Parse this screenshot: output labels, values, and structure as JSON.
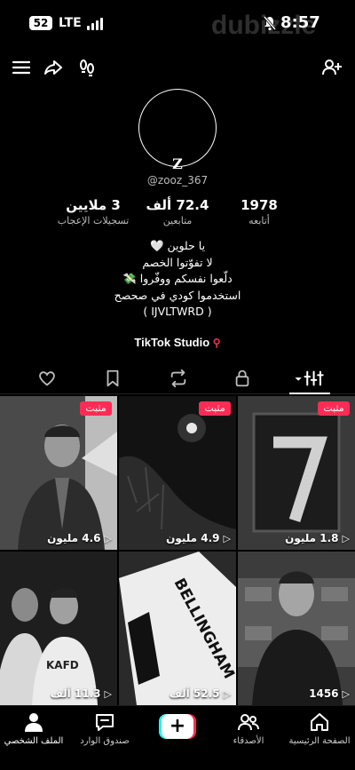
{
  "status_bar": {
    "signal_badge": "52",
    "network": "LTE",
    "watermark": "dubizzle",
    "time": "8:57"
  },
  "profile": {
    "display_name": "Z",
    "username": "@zooz_367",
    "stats": [
      {
        "value": "1978",
        "label": "أتابعه"
      },
      {
        "value": "72.4 ألف",
        "label": "متابعين"
      },
      {
        "value": "3 ملايين",
        "label": "تسجيلات الإعجاب"
      }
    ],
    "bio_lines": [
      "يا حلوين 🤍",
      "لا تفوّتوا الخصم",
      "دلّعوا نفسكم ووفّروا 💸",
      "استخدموا كودي في صحصح",
      "( IJVLTWRD )"
    ],
    "studio_label": "TikTok Studio"
  },
  "tabs": [
    {
      "name": "videos",
      "icon": "grid-icon",
      "active": true
    },
    {
      "name": "private",
      "icon": "lock-icon"
    },
    {
      "name": "reposts",
      "icon": "repost-icon"
    },
    {
      "name": "favorites",
      "icon": "bookmark-icon"
    },
    {
      "name": "liked",
      "icon": "heart-icon"
    }
  ],
  "videos": [
    {
      "pinned": true,
      "pin_label": "مثبت",
      "views": "1.8 مليون",
      "thumb": "number-7"
    },
    {
      "pinned": true,
      "pin_label": "مثبت",
      "views": "4.9 مليون",
      "thumb": "night-moon"
    },
    {
      "pinned": true,
      "pin_label": "مثبت",
      "views": "4.6 مليون",
      "thumb": "player-smiling"
    },
    {
      "pinned": false,
      "views": "1456",
      "thumb": "interview"
    },
    {
      "pinned": false,
      "views": "52.5 ألف",
      "thumb": "jersey-bellingham"
    },
    {
      "pinned": false,
      "views": "11.3 ألف",
      "thumb": "teammates"
    }
  ],
  "bottom_nav": [
    {
      "label": "الصفحة الرئيسية",
      "icon": "home-icon"
    },
    {
      "label": "الأصدقاء",
      "icon": "friends-icon"
    },
    {
      "label": "",
      "icon": "create-icon"
    },
    {
      "label": "صندوق الوارد",
      "icon": "inbox-icon"
    },
    {
      "label": "الملف الشخصي",
      "icon": "profile-icon"
    }
  ],
  "colors": {
    "accent": "#fe2c55",
    "cyan": "#25f4ee",
    "background": "#000000"
  }
}
